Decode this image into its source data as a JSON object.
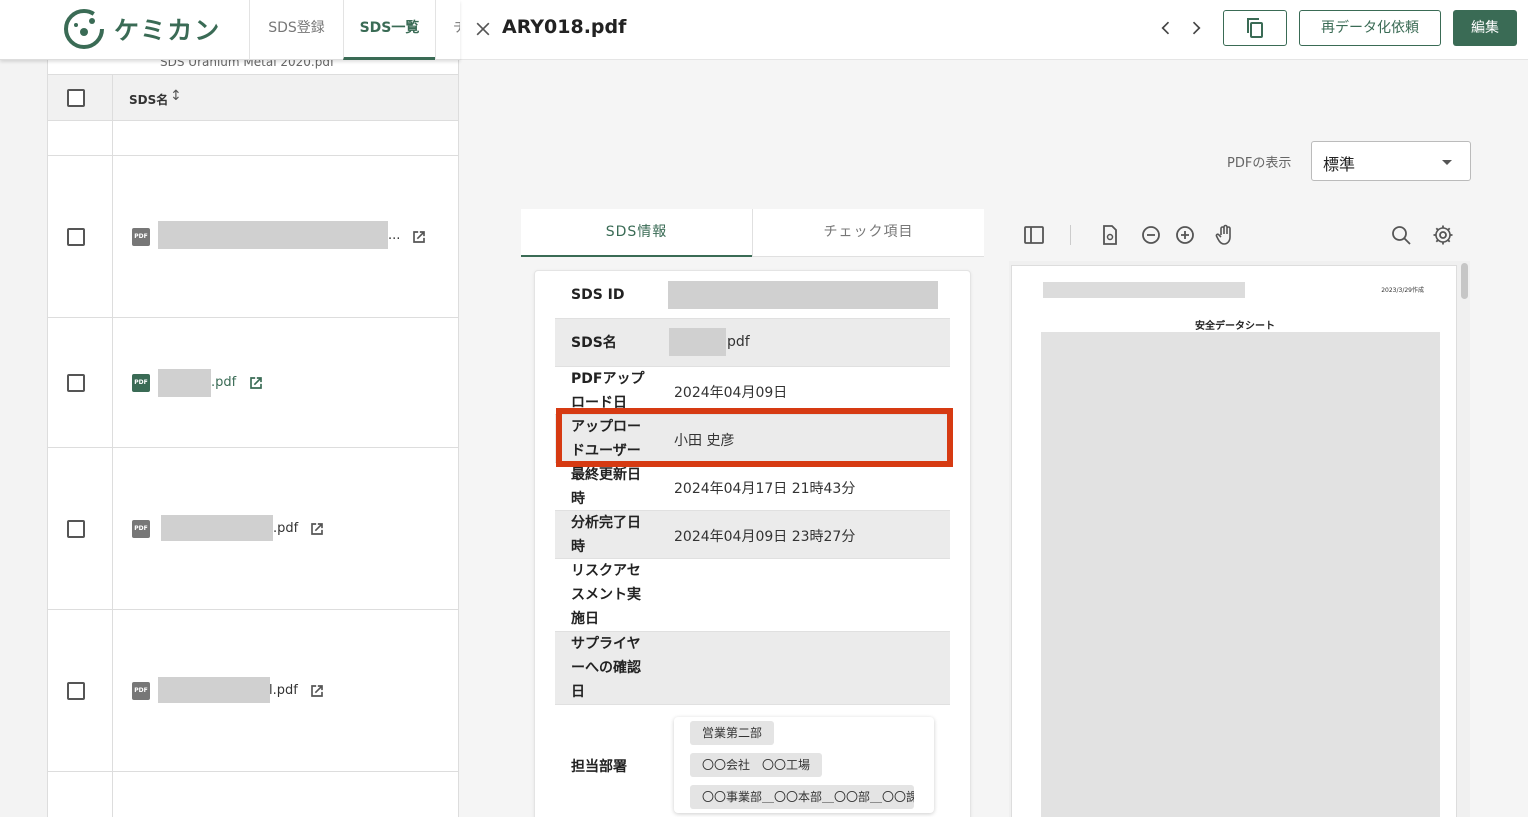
{
  "app": {
    "logo_text": "ケミカン",
    "nav": {
      "register": "SDS登録",
      "list": "SDS一覧",
      "more": "チ"
    },
    "table": {
      "hidden_row_text": "SDS Uranium Metal 2020.pdf",
      "header_name": "SDS名",
      "rows": [
        {
          "suffix": "..."
        },
        {
          "suffix": ".pdf"
        },
        {
          "suffix": ".pdf"
        },
        {
          "suffix": "l.pdf"
        }
      ]
    }
  },
  "drawer": {
    "title": "ARY018.pdf",
    "buttons": {
      "redata": "再データ化依頼",
      "edit": "編集"
    },
    "pdf_display": {
      "label": "PDFの表示",
      "value": "標準"
    },
    "tabs": {
      "sds_info": "SDS情報",
      "check": "チェック項目"
    },
    "info": {
      "sds_id_label": "SDS ID",
      "sds_name_label": "SDS名",
      "sds_name_suffix": "pdf",
      "upload_date_label": "PDFアップロード日",
      "upload_date": "2024年04月09日",
      "upload_user_label": "アップロードユーザー",
      "upload_user": "小田 史彦",
      "updated_label": "最終更新日時",
      "updated": "2024年04月17日 21時43分",
      "analyzed_label": "分析完了日時",
      "analyzed": "2024年04月09日 23時27分",
      "risk_label": "リスクアセスメント実施日",
      "supplier_label": "サプライヤーへの確認日",
      "dept_label": "担当部署",
      "departments": [
        "営業第二部",
        "〇〇会社　〇〇工場",
        "〇〇事業部＿〇〇本部＿〇〇部＿〇〇課"
      ]
    },
    "pdf_preview": {
      "date": "2023/3/29作成",
      "heading": "安全データシート"
    }
  },
  "colors": {
    "accent": "#3a6b55",
    "highlight": "#d63a12"
  }
}
